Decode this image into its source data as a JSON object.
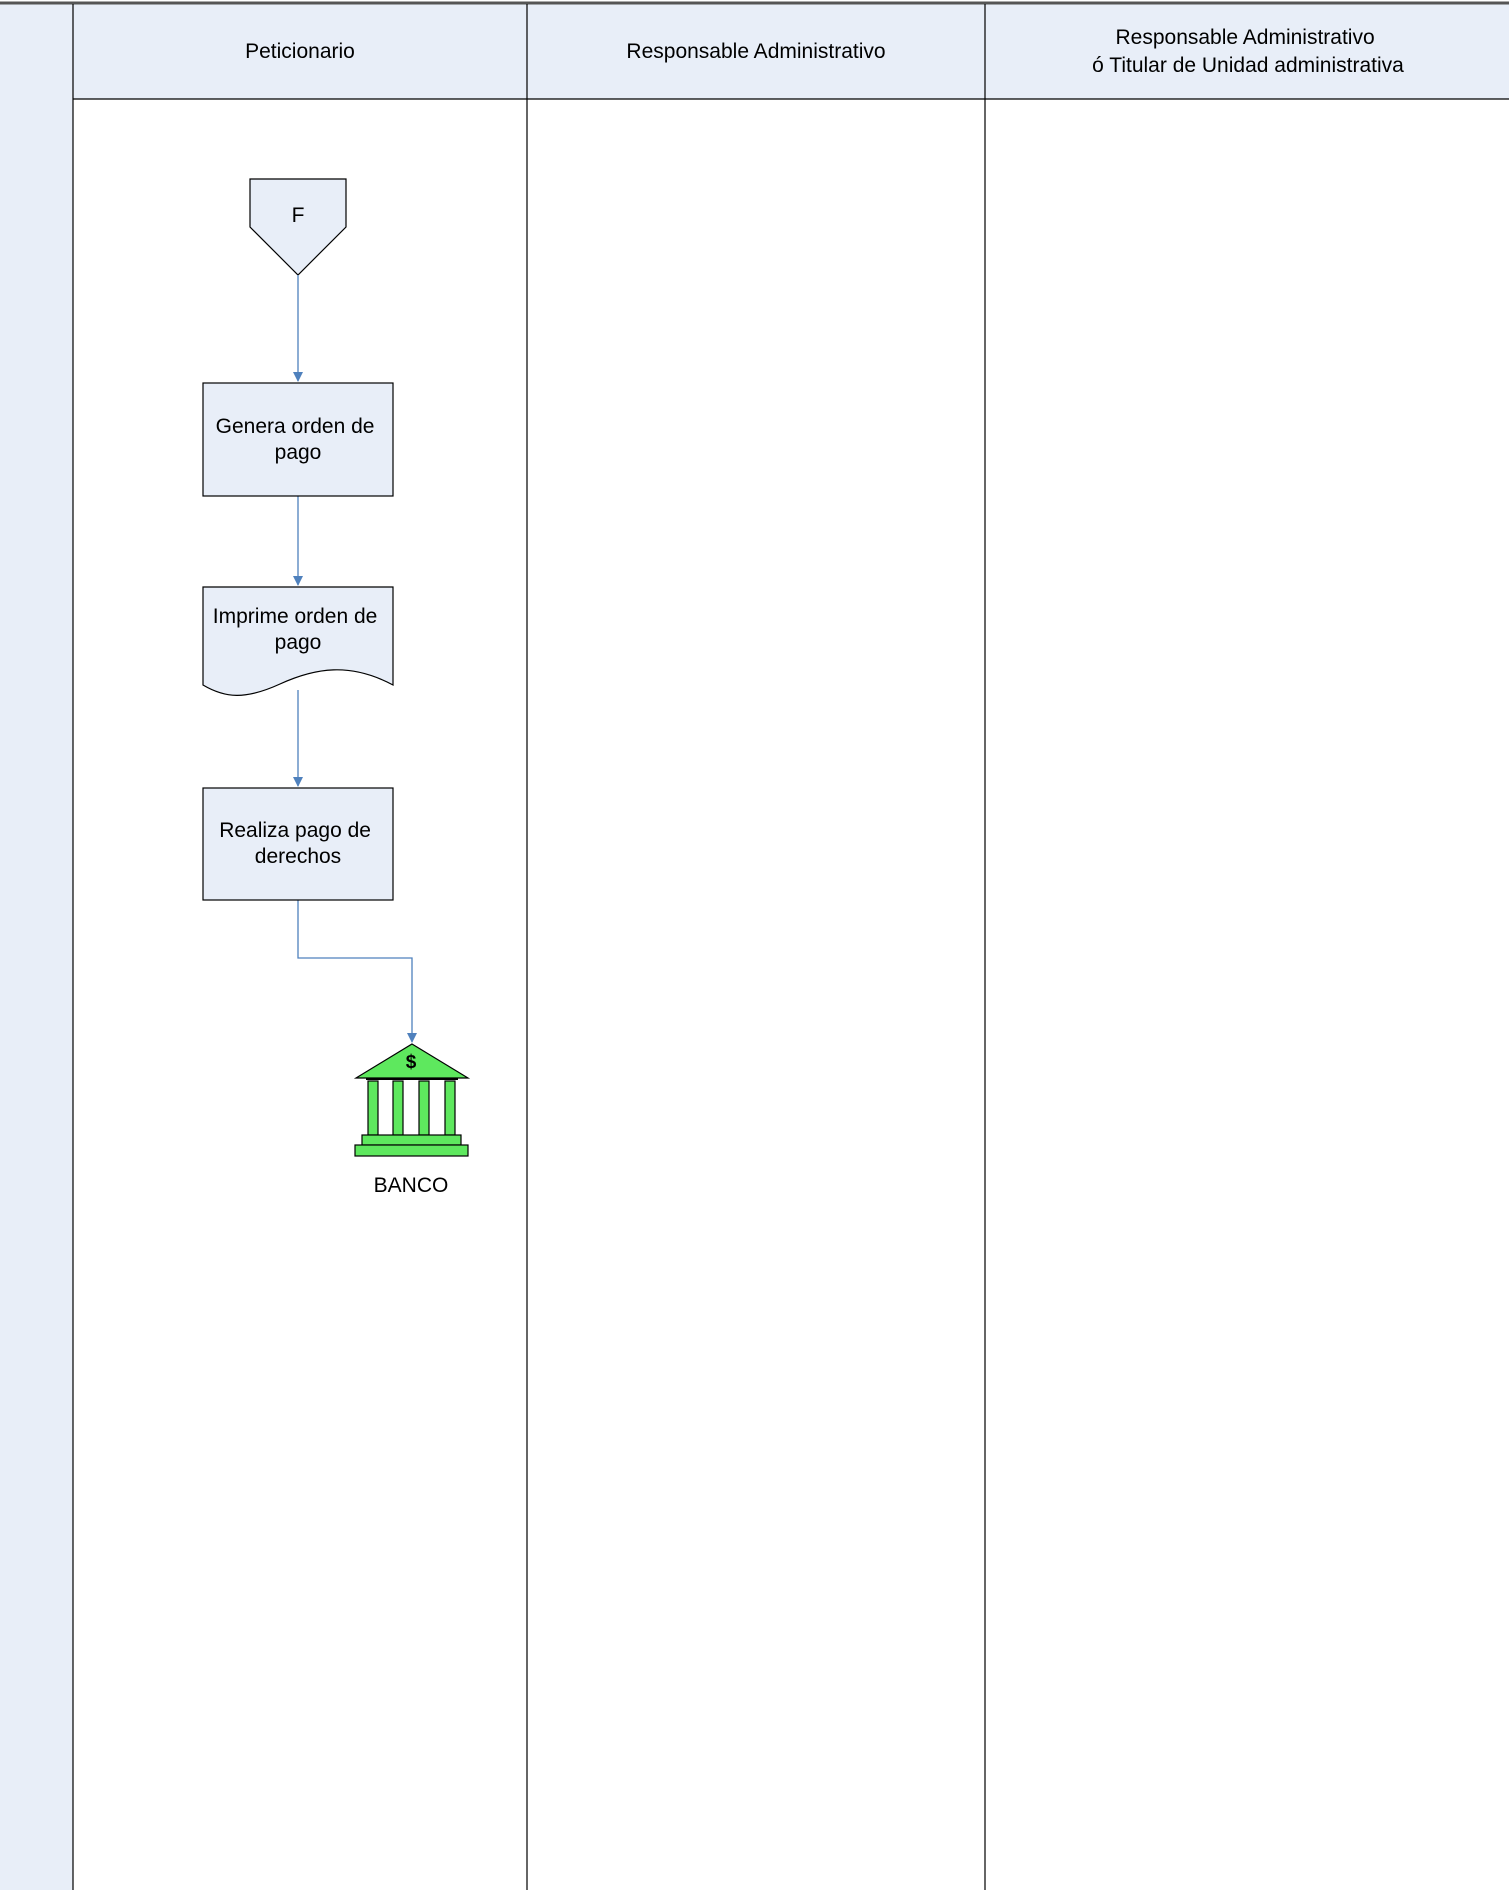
{
  "lanes": [
    {
      "title_lines": [
        "Peticionario"
      ]
    },
    {
      "title_lines": [
        "Responsable Administrativo"
      ]
    },
    {
      "title_lines": [
        "Responsable Administrativo",
        "ó Titular de Unidad administrativa"
      ]
    }
  ],
  "connector": {
    "label": "F"
  },
  "steps": {
    "genera": [
      "Genera orden de",
      "pago"
    ],
    "imprime": [
      "Imprime orden de",
      "pago"
    ],
    "realiza": [
      "Realiza pago de",
      "derechos"
    ]
  },
  "bank": {
    "symbol": "$",
    "label": "BANCO"
  },
  "colors": {
    "header_fill": "#e8eef8",
    "shape_fill": "#e8eef8",
    "arrow": "#4f81bd",
    "bank_fill": "#5ee85e",
    "border": "#000000"
  }
}
